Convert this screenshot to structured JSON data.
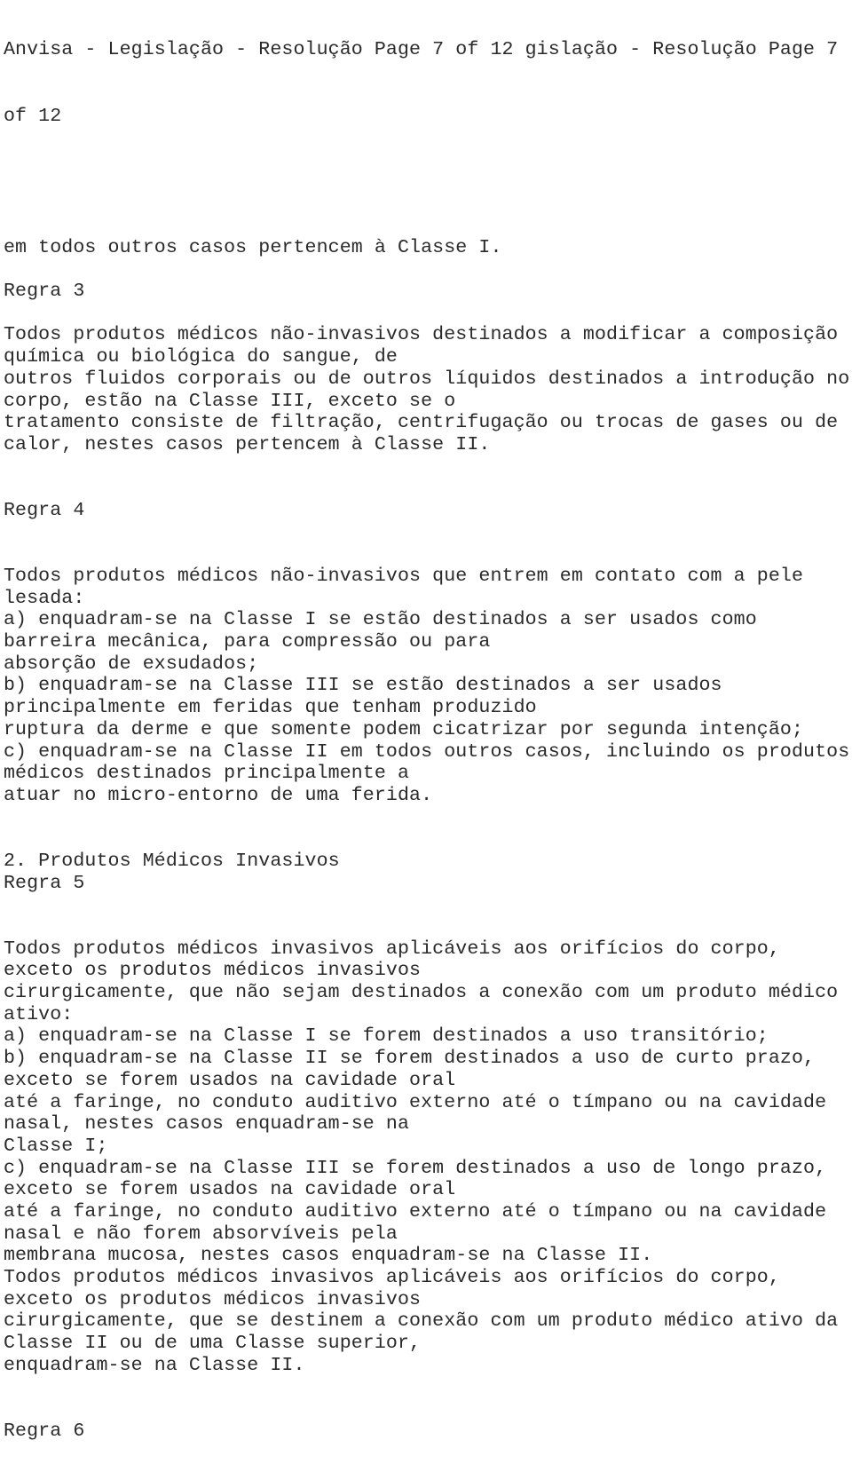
{
  "document": {
    "header": {
      "line1": "Anvisa - Legislação - Resolução Page 7 of 12 gislação - Resolução Page 7",
      "line2": "of 12"
    },
    "lines": [
      "em todos outros casos pertencem à Classe I.",
      "",
      "Regra 3",
      "",
      "Todos produtos médicos não-invasivos destinados a modificar a composição",
      "química ou biológica do sangue, de",
      "outros fluidos corporais ou de outros líquidos destinados a introdução no",
      "corpo, estão na Classe III, exceto se o",
      "tratamento consiste de filtração, centrifugação ou trocas de gases ou de",
      "calor, nestes casos pertencem à Classe II.",
      "",
      "",
      "Regra 4",
      "",
      "",
      "Todos produtos médicos não-invasivos que entrem em contato com a pele",
      "lesada:",
      "a) enquadram-se na Classe I se estão destinados a ser usados como",
      "barreira mecânica, para compressão ou para",
      "absorção de exsudados;",
      "b) enquadram-se na Classe III se estão destinados a ser usados",
      "principalmente em feridas que tenham produzido",
      "ruptura da derme e que somente podem cicatrizar por segunda intenção;",
      "c) enquadram-se na Classe II em todos outros casos, incluindo os produtos",
      "médicos destinados principalmente a",
      "atuar no micro-entorno de uma ferida.",
      "",
      "",
      "2. Produtos Médicos Invasivos",
      "Regra 5",
      "",
      "",
      "Todos produtos médicos invasivos aplicáveis aos orifícios do corpo,",
      "exceto os produtos médicos invasivos",
      "cirurgicamente, que não sejam destinados a conexão com um produto médico",
      "ativo:",
      "a) enquadram-se na Classe I se forem destinados a uso transitório;",
      "b) enquadram-se na Classe II se forem destinados a uso de curto prazo,",
      "exceto se forem usados na cavidade oral",
      "até a faringe, no conduto auditivo externo até o tímpano ou na cavidade",
      "nasal, nestes casos enquadram-se na",
      "Classe I;",
      "c) enquadram-se na Classe III se forem destinados a uso de longo prazo,",
      "exceto se forem usados na cavidade oral",
      "até a faringe, no conduto auditivo externo até o tímpano ou na cavidade",
      "nasal e não forem absorvíveis pela",
      "membrana mucosa, nestes casos enquadram-se na Classe II.",
      "Todos produtos médicos invasivos aplicáveis aos orifícios do corpo,",
      "exceto os produtos médicos invasivos",
      "cirurgicamente, que se destinem a conexão com um produto médico ativo da",
      "Classe II ou de uma Classe superior,",
      "enquadram-se na Classe II.",
      "",
      "",
      "Regra 6"
    ]
  }
}
